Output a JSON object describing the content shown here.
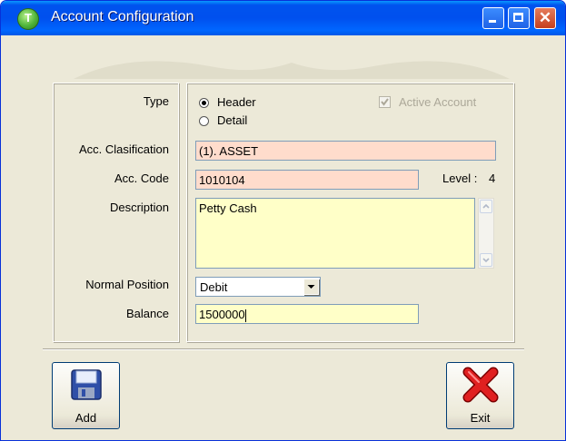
{
  "window": {
    "title": "Account Configuration",
    "minimize_glyph": "_",
    "close_glyph": "✕"
  },
  "form": {
    "type_label": "Type",
    "type_options": [
      "Header",
      "Detail"
    ],
    "type_selected": "Header",
    "active_account_label": "Active Account",
    "active_account_checked": true,
    "active_account_enabled": false,
    "classification_label": "Acc. Clasification",
    "classification_value": "(1). ASSET",
    "code_label": "Acc. Code",
    "code_value": "1010104",
    "level_label": "Level :",
    "level_value": "4",
    "description_label": "Description",
    "description_value": "Petty Cash",
    "normal_position_label": "Normal Position",
    "normal_position_value": "Debit",
    "balance_label": "Balance",
    "balance_value": "1500000"
  },
  "buttons": {
    "add_label": "Add",
    "exit_label": "Exit"
  },
  "colors": {
    "window_bg": "#ece9d8",
    "titlebar": "#0053ee",
    "readonly_field": "#ffdccc",
    "edit_field": "#ffffc8"
  }
}
